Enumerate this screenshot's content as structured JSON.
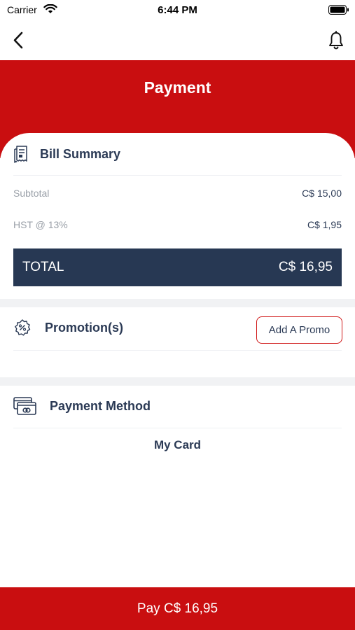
{
  "status_bar": {
    "carrier": "Carrier",
    "time": "6:44 PM"
  },
  "header": {
    "title": "Payment"
  },
  "bill_summary": {
    "title": "Bill Summary",
    "rows": [
      {
        "label": "Subtotal",
        "value": "C$ 15,00"
      },
      {
        "label": "HST @ 13%",
        "value": "C$ 1,95"
      }
    ],
    "total": {
      "label": "TOTAL",
      "value": "C$ 16,95"
    }
  },
  "promotions": {
    "title": "Promotion(s)",
    "button_label": "Add A Promo"
  },
  "payment_method": {
    "title": "Payment Method",
    "selected": "My Card"
  },
  "pay_button": {
    "label": "Pay C$ 16,95"
  },
  "colors": {
    "brand_red": "#c90e10",
    "navy": "#273853",
    "text": "#2b3a55",
    "muted": "#9aa0a8"
  },
  "icons": [
    "wifi-icon",
    "battery-icon",
    "back-chevron-icon",
    "bell-icon",
    "bill-icon",
    "promo-badge-icon",
    "cards-icon"
  ]
}
